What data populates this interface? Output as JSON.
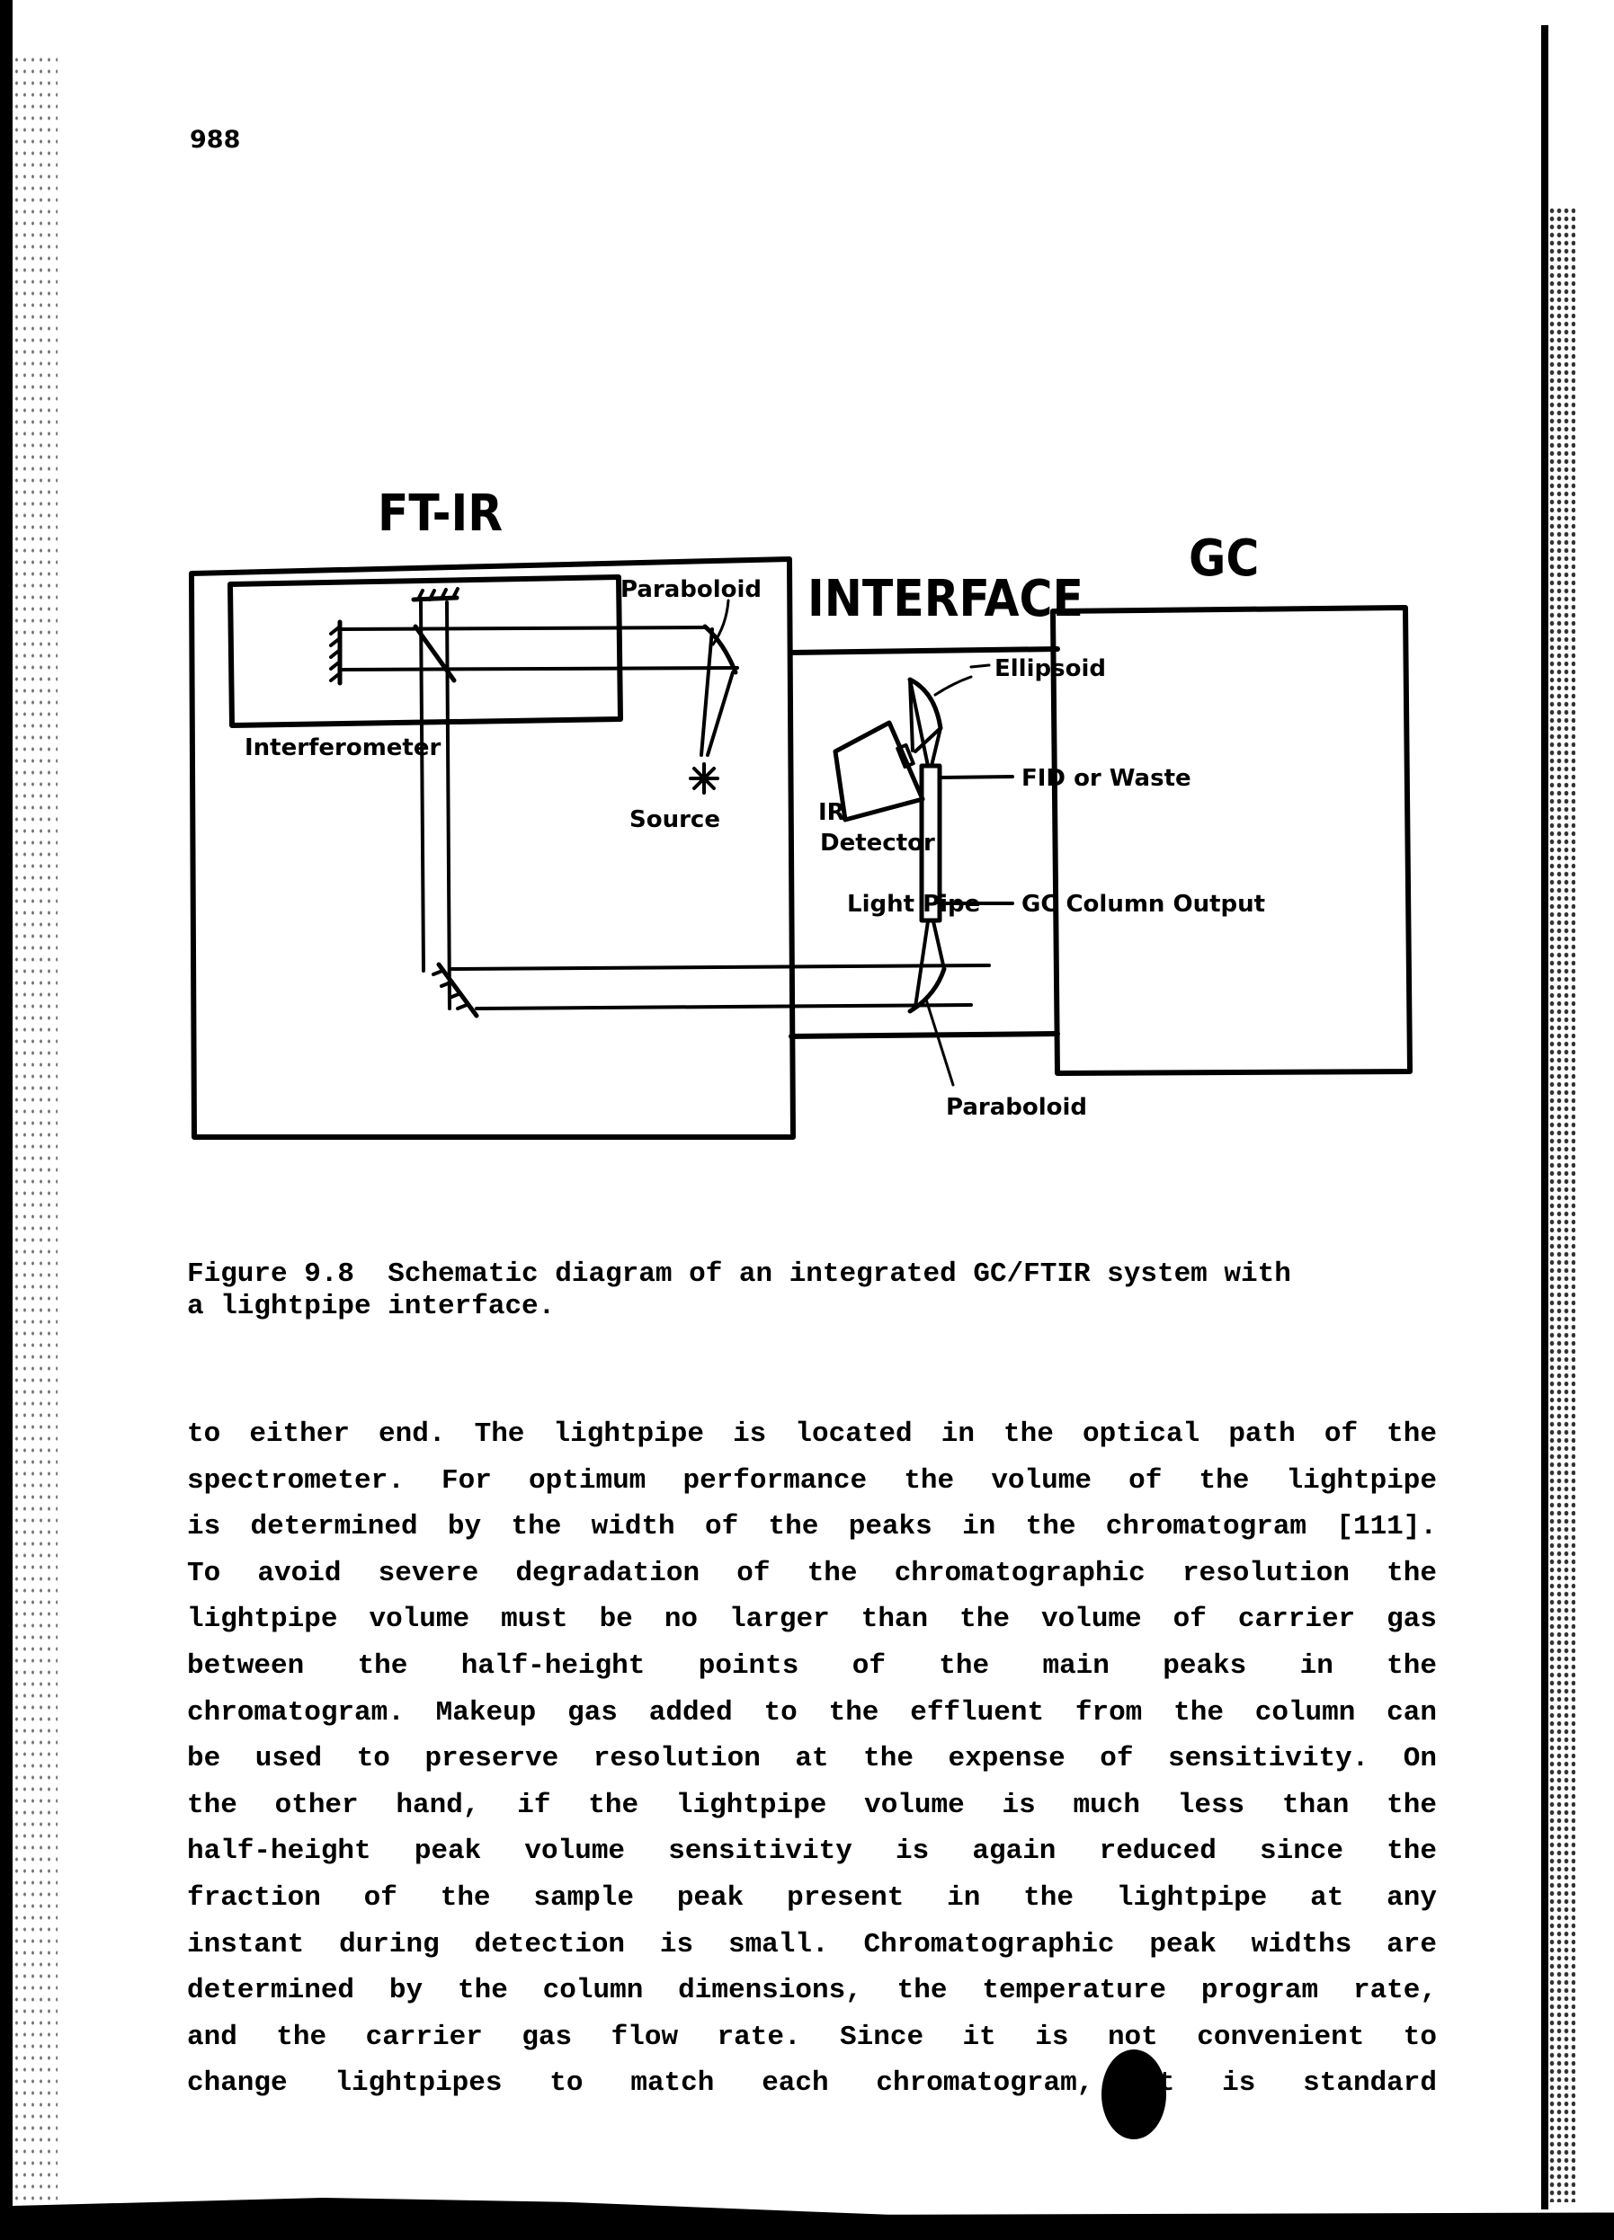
{
  "page": {
    "page_number": "988"
  },
  "diagram": {
    "title_ftir": "FT-IR",
    "title_interface": "INTERFACE",
    "title_gc": "GC",
    "labels": {
      "paraboloid_top": "Paraboloid",
      "interferometer": "Interferometer",
      "source": "Source",
      "ir": "IR",
      "detector": "Detector",
      "ellipsoid": "Ellipsoid",
      "fid_or_waste": "FID or Waste",
      "light_pipe": "Light Pipe",
      "gc_column_output": "GC Column Output",
      "paraboloid_bottom": "Paraboloid"
    }
  },
  "caption": {
    "line1": "Figure 9.8  Schematic diagram of an integrated GC/FTIR system with",
    "line2": "a lightpipe interface."
  },
  "body": {
    "lines": [
      "to either end. The lightpipe is located in the optical path of the",
      "spectrometer. For optimum performance the volume of the lightpipe",
      "is determined by the width of the peaks in the chromatogram [111].",
      "To avoid severe degradation of the chromatographic resolution the",
      "lightpipe volume must be no larger than the volume of carrier gas",
      "between the half-height points of the main peaks in the",
      "chromatogram. Makeup gas added to the effluent from the column can",
      "be used to preserve resolution at the expense of sensitivity. On",
      "the other hand, if the lightpipe volume is much less than the",
      "half-height peak volume sensitivity is again reduced since the",
      "fraction of the sample peak present in the lightpipe at any",
      "instant during detection is small. Chromatographic peak widths are",
      "determined by the column dimensions, the temperature program rate,",
      "and the carrier gas flow rate. Since it is not convenient to",
      "change lightpipes to match each chromatogram, it is standard"
    ]
  }
}
